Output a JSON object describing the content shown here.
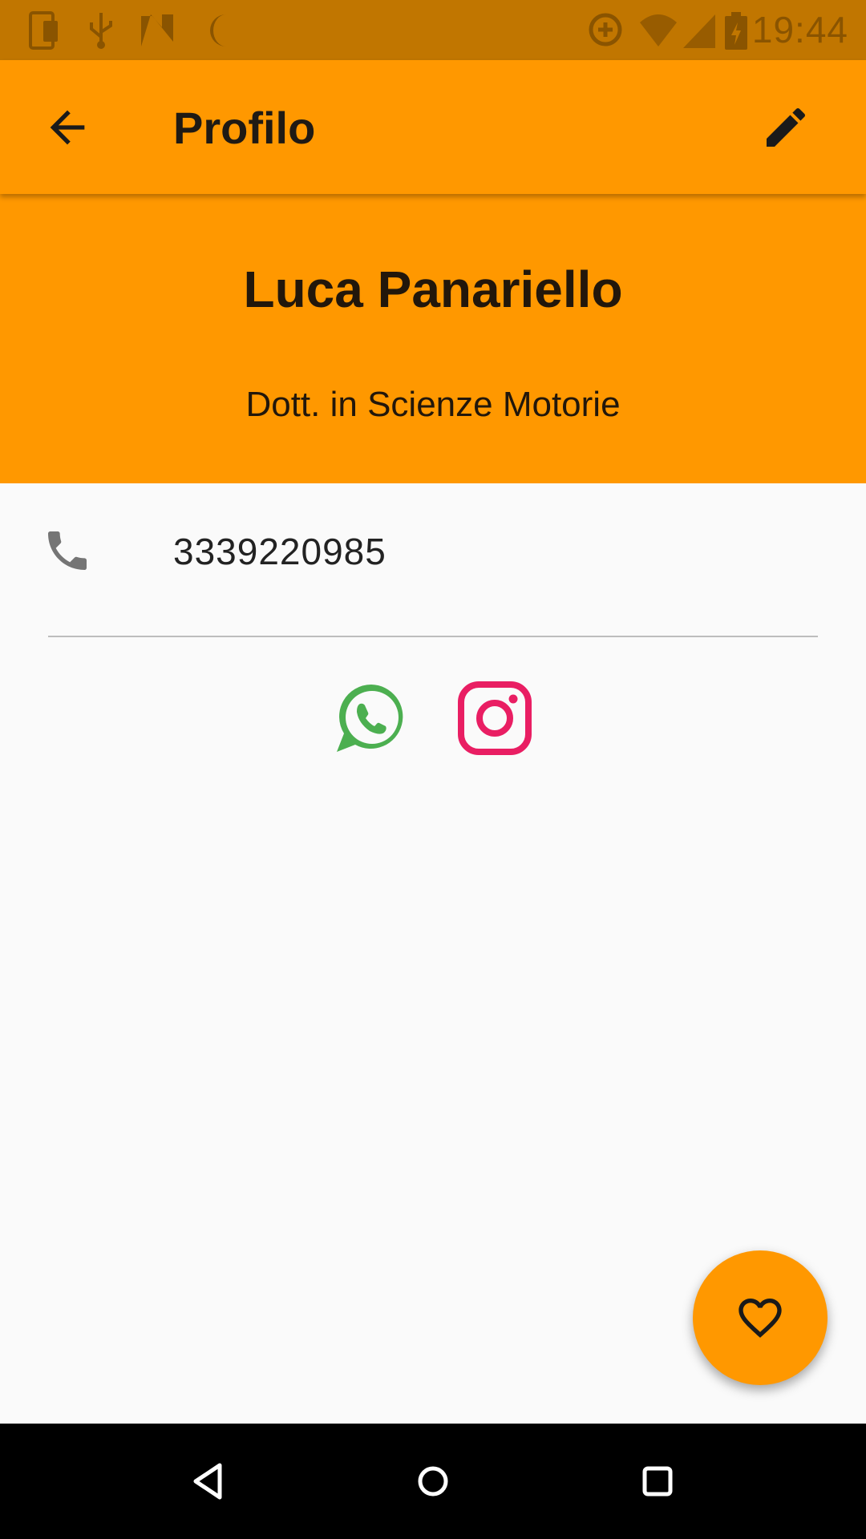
{
  "status_bar": {
    "time": "19:44",
    "left_icons": [
      "device-icon",
      "usb-icon",
      "n-logo-icon",
      "moon-icon"
    ],
    "right_icons": [
      "data-saver-icon",
      "wifi-icon",
      "signal-icon",
      "battery-charging-icon"
    ]
  },
  "app_bar": {
    "title": "Profilo",
    "back_icon": "arrow-back-icon",
    "edit_icon": "pencil-icon",
    "color": "#ff9800"
  },
  "profile": {
    "name": "Luca Panariello",
    "title": "Dott. in Scienze Motorie"
  },
  "contact": {
    "phone_icon": "phone-icon",
    "phone": "3339220985"
  },
  "social": {
    "whatsapp_icon": "whatsapp-icon",
    "whatsapp_color": "#4caf50",
    "instagram_icon": "instagram-icon",
    "instagram_color": "#e91e63"
  },
  "fab": {
    "icon": "heart-outline-icon",
    "color": "#ff9800"
  },
  "nav_bar": {
    "buttons": [
      "back-triangle-icon",
      "home-circle-icon",
      "recents-square-icon"
    ]
  }
}
